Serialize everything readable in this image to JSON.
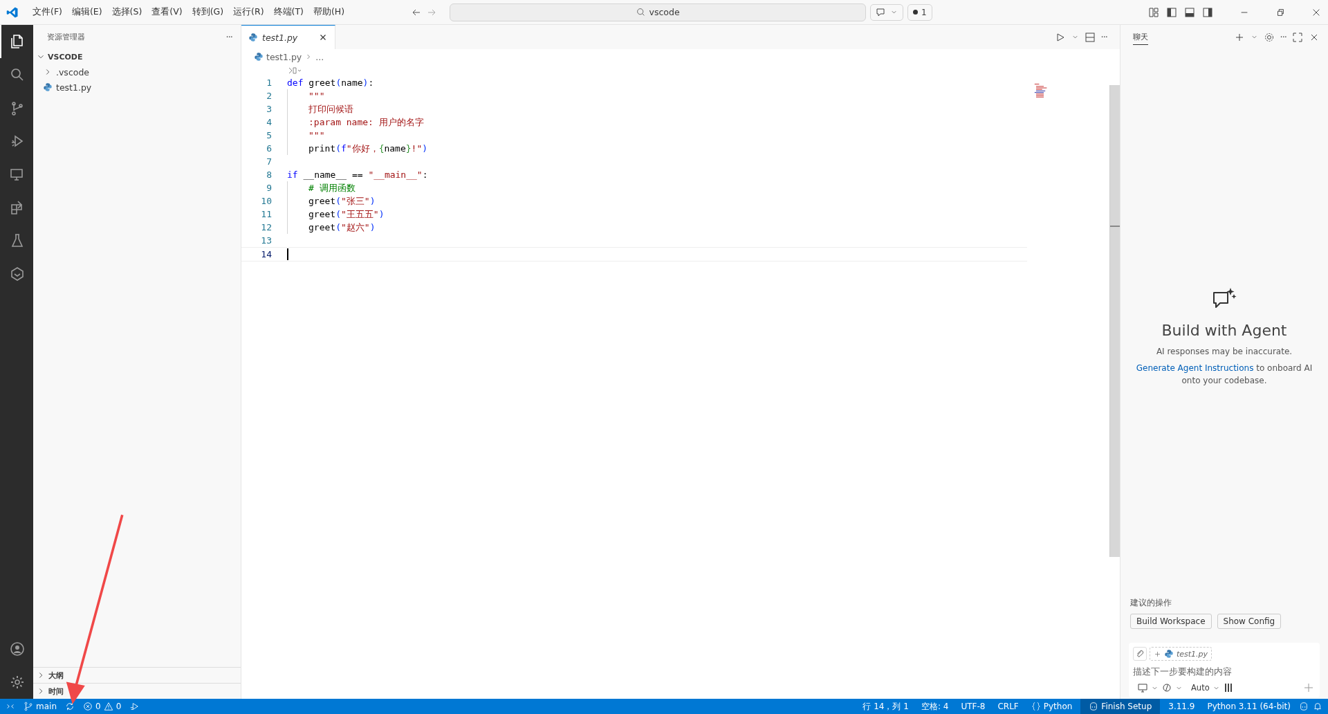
{
  "title_bar": {
    "menus": [
      "文件(F)",
      "编辑(E)",
      "选择(S)",
      "查看(V)",
      "转到(G)",
      "运行(R)",
      "终端(T)",
      "帮助(H)"
    ],
    "search": {
      "value": "vscode"
    },
    "badge": "1"
  },
  "activity_bar": {
    "items": [
      {
        "kind": "files",
        "selected": true
      },
      {
        "kind": "search",
        "selected": false
      },
      {
        "kind": "scm",
        "selected": false
      },
      {
        "kind": "debug",
        "selected": false
      },
      {
        "kind": "remote",
        "selected": false
      },
      {
        "kind": "extensions",
        "selected": false
      },
      {
        "kind": "testing",
        "selected": false
      },
      {
        "kind": "agent",
        "selected": false
      }
    ]
  },
  "sidebar": {
    "title": "资源管理器",
    "more": "···",
    "section": {
      "label": "VSCODE",
      "expanded": true
    },
    "items": [
      {
        "label": ".vscode",
        "kind": "folder",
        "expanded": false
      },
      {
        "label": "test1.py",
        "kind": "python"
      }
    ],
    "panels": [
      {
        "label": "大纲",
        "expanded": false
      },
      {
        "label": "时间",
        "expanded": false
      }
    ]
  },
  "editor": {
    "tabs": [
      {
        "label": "test1.py",
        "selected": true
      }
    ],
    "breadcrumb": [
      "test1.py",
      "..."
    ],
    "lines": [
      {
        "number": "1",
        "indented": false,
        "tokens": [
          {
            "kind": "kw",
            "text": "def"
          },
          {
            "kind": "text",
            "text": " greet"
          },
          {
            "kind": "paren",
            "text": "("
          },
          {
            "kind": "text",
            "text": "name"
          },
          {
            "kind": "paren",
            "text": ")"
          },
          {
            "kind": "text",
            "text": ":"
          }
        ]
      },
      {
        "number": "2",
        "indented": true,
        "tokens": [
          {
            "kind": "str",
            "text": "\"\"\""
          }
        ]
      },
      {
        "number": "3",
        "indented": true,
        "tokens": [
          {
            "kind": "str",
            "text": "打印问候语"
          }
        ]
      },
      {
        "number": "4",
        "indented": true,
        "tokens": [
          {
            "kind": "str",
            "text": ":param name: 用户的名字"
          }
        ]
      },
      {
        "number": "5",
        "indented": true,
        "tokens": [
          {
            "kind": "str",
            "text": "\"\"\""
          }
        ]
      },
      {
        "number": "6",
        "indented": true,
        "tokens": [
          {
            "kind": "text",
            "text": "print"
          },
          {
            "kind": "paren",
            "text": "("
          },
          {
            "kind": "kw",
            "text": "f"
          },
          {
            "kind": "str",
            "text": "\"你好，"
          },
          {
            "kind": "brace",
            "text": "{"
          },
          {
            "kind": "text",
            "text": "name"
          },
          {
            "kind": "brace",
            "text": "}"
          },
          {
            "kind": "str",
            "text": "!\""
          },
          {
            "kind": "paren",
            "text": ")"
          }
        ]
      },
      {
        "number": "7",
        "indented": false
      },
      {
        "number": "8",
        "indented": false,
        "tokens": [
          {
            "kind": "kw",
            "text": "if"
          },
          {
            "kind": "text",
            "text": " __name__ == "
          },
          {
            "kind": "str",
            "text": "\"__main__\""
          },
          {
            "kind": "text",
            "text": ":"
          }
        ]
      },
      {
        "number": "9",
        "indented": true,
        "tokens": [
          {
            "kind": "cmt",
            "text": "# 调用函数"
          }
        ]
      },
      {
        "number": "10",
        "indented": true,
        "tokens": [
          {
            "kind": "text",
            "text": "greet"
          },
          {
            "kind": "paren",
            "text": "("
          },
          {
            "kind": "str",
            "text": "\"张三\""
          },
          {
            "kind": "paren",
            "text": ")"
          }
        ]
      },
      {
        "number": "11",
        "indented": true,
        "tokens": [
          {
            "kind": "text",
            "text": "greet"
          },
          {
            "kind": "paren",
            "text": "("
          },
          {
            "kind": "str",
            "text": "\"王五五\""
          },
          {
            "kind": "paren",
            "text": ")"
          }
        ]
      },
      {
        "number": "12",
        "indented": true,
        "tokens": [
          {
            "kind": "text",
            "text": "greet"
          },
          {
            "kind": "paren",
            "text": "("
          },
          {
            "kind": "str",
            "text": "\"赵六\""
          },
          {
            "kind": "paren",
            "text": ")"
          }
        ]
      },
      {
        "number": "13",
        "indented": false
      },
      {
        "number": "14",
        "indented": false,
        "current": true
      }
    ],
    "more": "···"
  },
  "chat": {
    "tab": "聊天",
    "more": "···",
    "heading": "Build with Agent",
    "note": "AI responses may be inaccurate.",
    "link": "Generate Agent Instructions",
    "link_rest": " to onboard AI onto your codebase.",
    "suggestions_label": "建议的操作",
    "suggestions": [
      "Build Workspace",
      "Show Config"
    ],
    "context_file": "test1.py",
    "placeholder": "描述下一步要构建的内容",
    "model": "Auto"
  },
  "status_bar": {
    "branch": "main",
    "errors": "0",
    "warnings": "0",
    "right": [
      {
        "kind": "text",
        "text": "行 14，列 1"
      },
      {
        "kind": "text",
        "text": "空格: 4"
      },
      {
        "kind": "text",
        "text": "UTF-8"
      },
      {
        "kind": "text",
        "text": "CRLF"
      },
      {
        "kind": "language",
        "text": "Python"
      },
      {
        "kind": "setup",
        "text": "Finish Setup"
      },
      {
        "kind": "text",
        "text": "3.11.9"
      },
      {
        "kind": "text",
        "text": "Python 3.11 (64-bit)"
      }
    ]
  }
}
